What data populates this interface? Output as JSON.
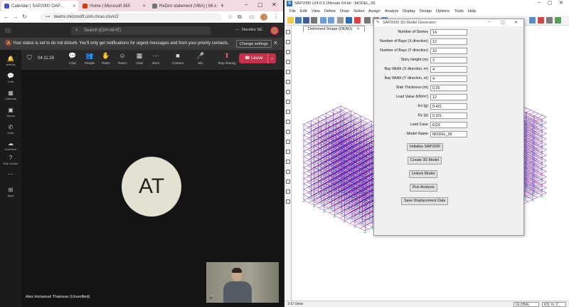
{
  "browser": {
    "tabs": [
      {
        "label": "Calendar | SAP2000 OAP…",
        "fav_color": "#4b53bc"
      },
      {
        "label": "Home | Microsoft 365",
        "fav_color": "#d83b01"
      },
      {
        "label": "ReDim statement (VBA) | Mi…",
        "fav_color": "#737373"
      }
    ],
    "url": "teams.microsoft.com.mcas.ms/v2/"
  },
  "teams": {
    "search_placeholder": "Search (Ctrl+Alt+E)",
    "org_name": "Noveles SE",
    "banner_message": "Your status is set to do not disturb. You'll only get notifications for urgent messages and from your priority contacts.",
    "change_settings_label": "Change settings",
    "meeting_timer": "04:11:26",
    "controls": [
      {
        "icon": "chat-icon",
        "glyph": "💬",
        "label": "Chat"
      },
      {
        "icon": "people-icon",
        "glyph": "👥",
        "label": "People",
        "badge": "2"
      },
      {
        "icon": "raise-hand-icon",
        "glyph": "✋",
        "label": "Raise"
      },
      {
        "icon": "react-icon",
        "glyph": "☺",
        "label": "React"
      },
      {
        "icon": "view-icon",
        "glyph": "▦",
        "label": "View"
      },
      {
        "icon": "more-icon",
        "glyph": "⋯",
        "label": "More"
      },
      {
        "icon": "camera-icon",
        "glyph": "■",
        "label": "Camera"
      },
      {
        "icon": "mic-icon",
        "glyph": "🎤",
        "label": "Mic"
      },
      {
        "icon": "share-icon",
        "glyph": "⬆",
        "label": "Stop sharing"
      }
    ],
    "leave_label": "Leave",
    "rail": [
      {
        "icon": "activity-icon",
        "glyph": "🔔",
        "label": "Activity"
      },
      {
        "icon": "chat-rail-icon",
        "glyph": "💬",
        "label": "Chat"
      },
      {
        "icon": "calendar-icon",
        "glyph": "▦",
        "label": "Calendar"
      },
      {
        "icon": "teams-icon",
        "glyph": "▣",
        "label": "Teams"
      },
      {
        "icon": "calls-icon",
        "glyph": "✆",
        "label": "Calls"
      },
      {
        "icon": "onedrive-icon",
        "glyph": "☁",
        "label": "OneDrive"
      },
      {
        "icon": "help-icon",
        "glyph": "?",
        "label": "Help Center"
      },
      {
        "icon": "more-rail-icon",
        "glyph": "⋯",
        "label": ""
      },
      {
        "icon": "apps-icon",
        "glyph": "⊞",
        "label": "Apps"
      }
    ],
    "participant_initials": "AT",
    "participant_name": "Alex Immanuel Thainese (Unverified)"
  },
  "sap": {
    "title": "SAP2000 v24.0.0 Ultimate 64-bit - MODEL_06",
    "menu": [
      "File",
      "Edit",
      "View",
      "Define",
      "Draw",
      "Select",
      "Assign",
      "Analyze",
      "Display",
      "Design",
      "Options",
      "Tools",
      "Help"
    ],
    "view_tab": "Deformed Shape (DEAD)",
    "status_left": "3-D View",
    "coord_system": "GLOBAL",
    "units": "KN, m, C"
  },
  "dialog": {
    "title": "SAP2000 3D Model Generator",
    "fields": [
      {
        "label": "Number of Stories",
        "value": "14"
      },
      {
        "label": "Number of Bays (X direction)",
        "value": "12"
      },
      {
        "label": "Number of Bays (Y direction)",
        "value": "10"
      },
      {
        "label": "Story Height (m)",
        "value": "3"
      },
      {
        "label": "Bay Width (X direction, m)",
        "value": "4"
      },
      {
        "label": "Bay Width (Y direction, m)",
        "value": "4"
      },
      {
        "label": "Slab Thickness (m)",
        "value": "0.25"
      },
      {
        "label": "Load Value (kN/m²)",
        "value": "12"
      },
      {
        "label": "Ex (g)",
        "value": "0.421"
      },
      {
        "label": "Ey (g)",
        "value": "0.321"
      },
      {
        "label": "Load Case",
        "value": "EQX"
      },
      {
        "label": "Model Name",
        "value": "MODEL_06"
      }
    ],
    "buttons": [
      {
        "label": "Initialize SAP2000",
        "name": "initialize-sap2000-button"
      },
      {
        "label": "Create 3D Model",
        "name": "create-3d-model-button"
      },
      {
        "label": "Unlock Model",
        "name": "unlock-model-button"
      },
      {
        "label": "Run Analysis",
        "name": "run-analysis-button"
      },
      {
        "label": "Save Displacement Data",
        "name": "save-displacement-data-button"
      }
    ]
  },
  "colors": {
    "leave": "#c4314b",
    "frame_blue": "#3a2fc9",
    "frame_magenta": "#c2248a",
    "support_green": "#1ec28b"
  }
}
